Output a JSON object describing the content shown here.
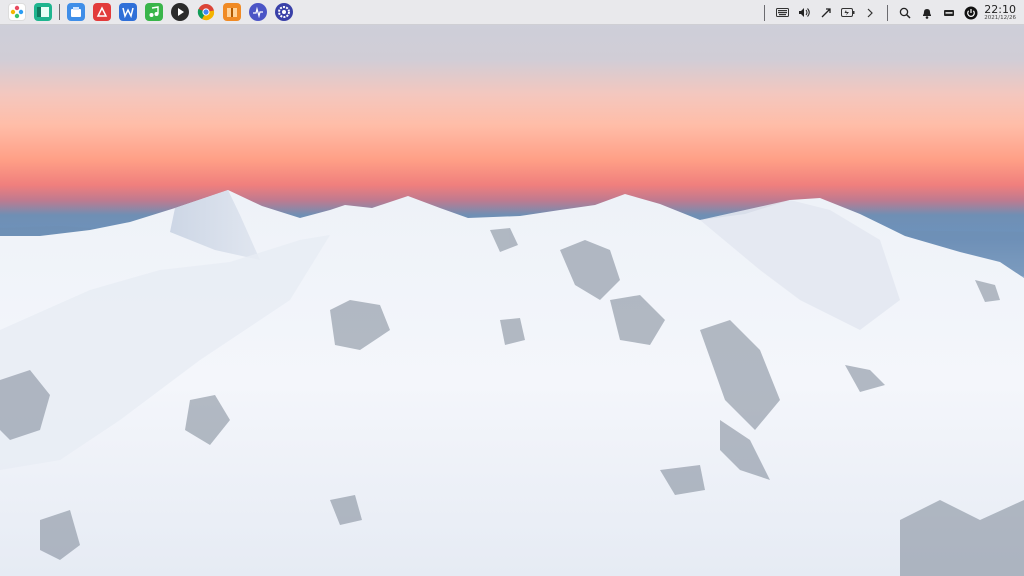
{
  "taskbar": {
    "launcher_apps": [
      {
        "icon": "launcher-icon"
      },
      {
        "icon": "file-manager-icon"
      },
      {
        "icon": "app-store-icon"
      },
      {
        "icon": "pdf-reader-icon"
      },
      {
        "icon": "office-writer-icon"
      },
      {
        "icon": "music-player-icon"
      },
      {
        "icon": "video-player-icon"
      },
      {
        "icon": "chrome-browser-icon"
      },
      {
        "icon": "archive-manager-icon"
      },
      {
        "icon": "system-monitor-icon"
      },
      {
        "icon": "settings-icon"
      }
    ],
    "tray_icons": [
      "keyboard-icon",
      "volume-icon",
      "bluetooth-icon",
      "battery-icon",
      "chevron-right-icon",
      "search-icon",
      "bell-icon",
      "notes-icon",
      "power-icon"
    ]
  },
  "clock": {
    "time": "22:10",
    "date": "2021/12/26"
  },
  "colors": {
    "panel": "#e9e9ec",
    "sky_pink": "#ff9f86",
    "sky_blue": "#6e93bd",
    "snow": "#f2f5fa"
  }
}
